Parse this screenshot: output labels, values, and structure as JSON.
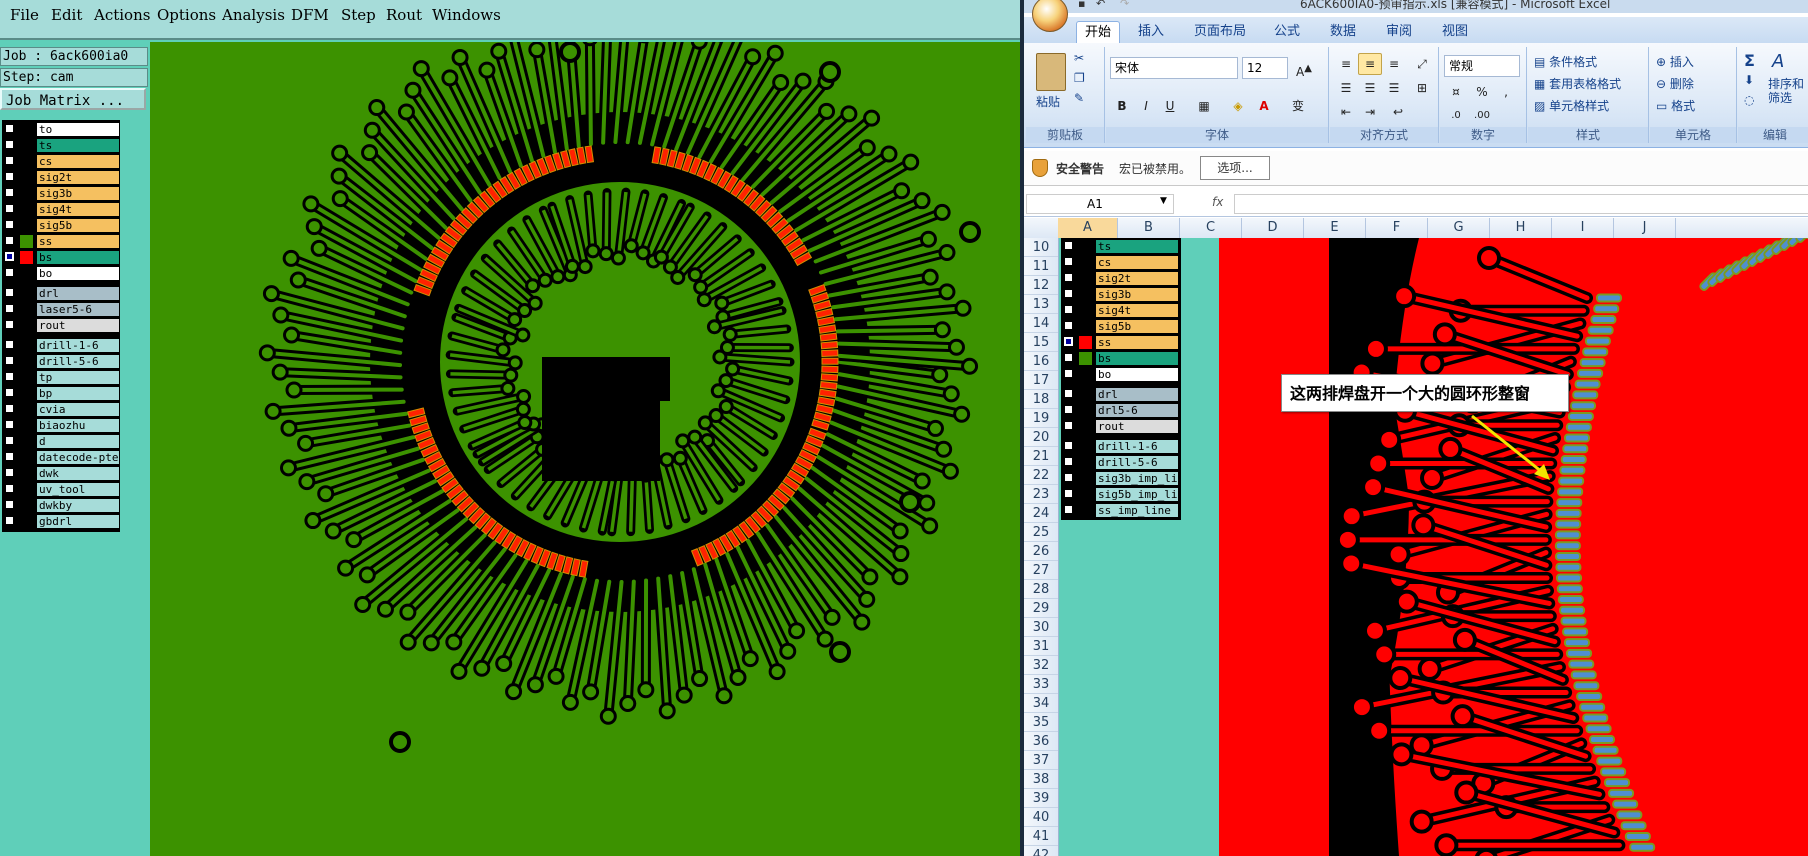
{
  "cam": {
    "menu": [
      "File",
      "Edit",
      "Actions",
      "Options",
      "Analysis",
      "DFM",
      "Step",
      "Rout",
      "Windows"
    ],
    "job_line": "Job : 6ack600ia0",
    "step_line": "Step: cam",
    "job_matrix_label": "Job Matrix ...",
    "layers": [
      {
        "name": "to",
        "bg": "#ffffff",
        "sw": "#000000"
      },
      {
        "name": "ts",
        "bg": "#1aa37f",
        "sw": "#000000"
      },
      {
        "name": "cs",
        "bg": "#f5c060",
        "sw": "#000000"
      },
      {
        "name": "sig2t",
        "bg": "#f5c060",
        "sw": "#000000"
      },
      {
        "name": "sig3b",
        "bg": "#f5c060",
        "sw": "#000000"
      },
      {
        "name": "sig4t",
        "bg": "#f5c060",
        "sw": "#000000"
      },
      {
        "name": "sig5b",
        "bg": "#f5c060",
        "sw": "#000000"
      },
      {
        "name": "ss",
        "bg": "#f5c060",
        "sw": "#3c9200"
      },
      {
        "name": "bs",
        "bg": "#1aa37f",
        "sw": "#ff0000",
        "active": true
      },
      {
        "name": "bo",
        "bg": "#ffffff",
        "sw": "#000000"
      },
      {
        "name": "drl",
        "bg": "#a8bec8",
        "sw": "#000000",
        "gap": true
      },
      {
        "name": "laser5-6",
        "bg": "#a8bec8",
        "sw": "#000000"
      },
      {
        "name": "rout",
        "bg": "#dcdcdc",
        "sw": "#000000"
      },
      {
        "name": "drill-1-6",
        "bg": "#a6dcd9",
        "sw": "#000000",
        "gap": true
      },
      {
        "name": "drill-5-6",
        "bg": "#a6dcd9",
        "sw": "#000000"
      },
      {
        "name": "tp",
        "bg": "#a6dcd9",
        "sw": "#000000"
      },
      {
        "name": "bp",
        "bg": "#a6dcd9",
        "sw": "#000000"
      },
      {
        "name": "cvia",
        "bg": "#a6dcd9",
        "sw": "#000000"
      },
      {
        "name": "biaozhu",
        "bg": "#a6dcd9",
        "sw": "#000000"
      },
      {
        "name": "d",
        "bg": "#a6dcd9",
        "sw": "#000000"
      },
      {
        "name": "datecode-pte",
        "bg": "#a6dcd9",
        "sw": "#000000"
      },
      {
        "name": "dwk",
        "bg": "#a6dcd9",
        "sw": "#000000"
      },
      {
        "name": "uv_tool",
        "bg": "#a6dcd9",
        "sw": "#000000"
      },
      {
        "name": "dwkby",
        "bg": "#a6dcd9",
        "sw": "#000000"
      },
      {
        "name": "gbdrl",
        "bg": "#a6dcd9",
        "sw": "#000000"
      }
    ]
  },
  "excel": {
    "title": "6ACK600IA0-预审指示.xls [兼容模式] - Microsoft Excel",
    "tabs": [
      "开始",
      "插入",
      "页面布局",
      "公式",
      "数据",
      "审阅",
      "视图"
    ],
    "ribbon": {
      "paste_label": "粘贴",
      "clipboard_group": "剪贴板",
      "font_name": "宋体",
      "font_size": "12",
      "font_group": "字体",
      "align_group": "对齐方式",
      "number_format": "常规",
      "number_group": "数字",
      "cond_format": "条件格式",
      "table_format": "套用表格格式",
      "cell_style": "单元格样式",
      "style_group": "样式",
      "insert": "插入",
      "delete": "删除",
      "format": "格式",
      "cells_group": "单元格",
      "sort_filter": "排序和筛选",
      "edit_group": "编辑"
    },
    "security": {
      "title": "安全警告",
      "message": "宏已被禁用。",
      "options_button": "选项..."
    },
    "name_box": "A1",
    "fx": "fx",
    "columns": [
      "A",
      "B",
      "C",
      "D",
      "E",
      "F",
      "G",
      "H",
      "I",
      "J"
    ],
    "rows": [
      "10",
      "11",
      "12",
      "13",
      "14",
      "15",
      "16",
      "17",
      "18",
      "19",
      "20",
      "21",
      "22",
      "23",
      "24",
      "25",
      "26",
      "27",
      "28",
      "29",
      "30",
      "31",
      "32",
      "33",
      "34",
      "35",
      "36",
      "37",
      "38",
      "39",
      "40",
      "41",
      "42"
    ],
    "embedded_layers": [
      {
        "name": "ts",
        "bg": "#1aa37f",
        "sw": "#000000"
      },
      {
        "name": "cs",
        "bg": "#f5c060",
        "sw": "#000000"
      },
      {
        "name": "sig2t",
        "bg": "#f5c060",
        "sw": "#000000"
      },
      {
        "name": "sig3b",
        "bg": "#f5c060",
        "sw": "#000000"
      },
      {
        "name": "sig4t",
        "bg": "#f5c060",
        "sw": "#000000"
      },
      {
        "name": "sig5b",
        "bg": "#f5c060",
        "sw": "#000000"
      },
      {
        "name": "ss",
        "bg": "#f5c060",
        "sw": "#ff0000",
        "active": true
      },
      {
        "name": "bs",
        "bg": "#1aa37f",
        "sw": "#3c9200"
      },
      {
        "name": "bo",
        "bg": "#ffffff",
        "sw": "#000000"
      },
      {
        "name": "drl",
        "bg": "#a8bec8",
        "sw": "#000000",
        "gap": true
      },
      {
        "name": "drl5-6",
        "bg": "#a8bec8",
        "sw": "#000000"
      },
      {
        "name": "rout",
        "bg": "#dcdcdc",
        "sw": "#000000"
      },
      {
        "name": "drill-1-6",
        "bg": "#a6dcd9",
        "sw": "#000000",
        "gap": true
      },
      {
        "name": "drill-5-6",
        "bg": "#a6dcd9",
        "sw": "#000000"
      },
      {
        "name": "sig3b_imp_li",
        "bg": "#a6dcd9",
        "sw": "#000000"
      },
      {
        "name": "sig5b_imp_li",
        "bg": "#a6dcd9",
        "sw": "#000000"
      },
      {
        "name": "ss_imp_line",
        "bg": "#a6dcd9",
        "sw": "#000000"
      }
    ],
    "note_text": "这两排焊盘开一个大的圆环形整窗"
  }
}
